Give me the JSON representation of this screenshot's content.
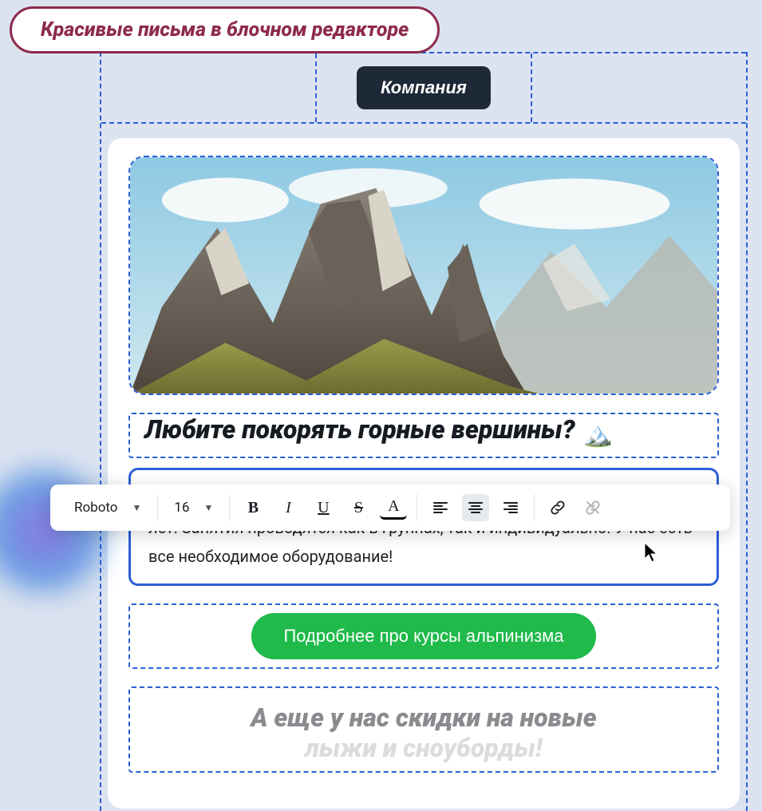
{
  "callout": {
    "text": "Красивые письма в блочном редакторе"
  },
  "header": {
    "company_label": "Компания"
  },
  "heading": {
    "text": "Любите покорять горные вершины?",
    "icon_name": "mountain-icon"
  },
  "paragraph": {
    "text": "Мы открываем набор на курсы альпинизма для взрослых и детей от 6 лет. Занятия проводятся как в группах, так и индивидуально. У нас есть все необходимое оборудование!"
  },
  "cta": {
    "label": "Подробнее про курсы альпинизма"
  },
  "heading2": {
    "line1": "А еще у нас скидки на новые",
    "line2": "лыжи и сноуборды!"
  },
  "toolbar": {
    "font_family": "Roboto",
    "font_size": "16",
    "bold": "B",
    "italic": "I",
    "underline": "U",
    "strike": "S",
    "text_color": "A"
  }
}
